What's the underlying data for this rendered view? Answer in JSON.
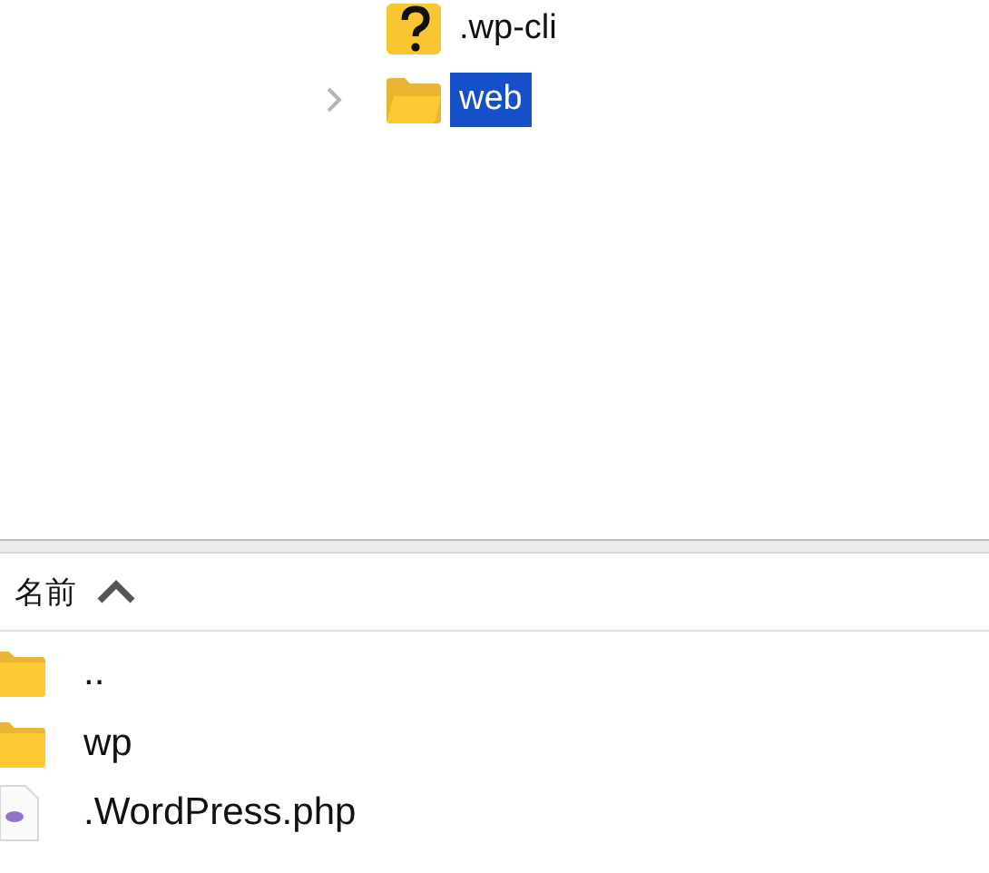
{
  "tree": {
    "items": [
      {
        "label": ".wp-cli",
        "kind": "unknown",
        "selected": false
      },
      {
        "label": "web",
        "kind": "folder",
        "expanded": false,
        "selected": true
      }
    ]
  },
  "file_list": {
    "columns": [
      {
        "label": "名前",
        "sort_ascending": true
      }
    ],
    "rows": [
      {
        "name": "..",
        "kind": "folder"
      },
      {
        "name": "wp",
        "kind": "folder"
      },
      {
        "name": ".WordPress.php",
        "kind": "php"
      }
    ]
  }
}
